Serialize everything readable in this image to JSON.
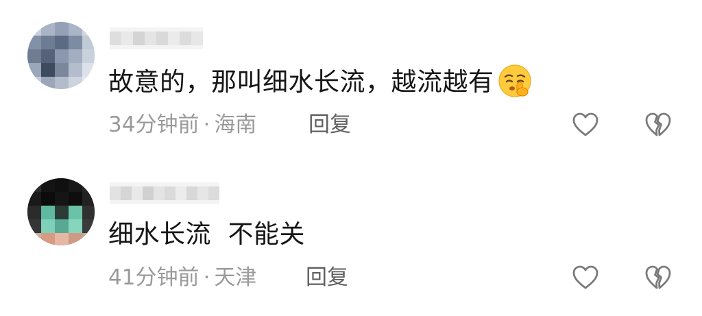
{
  "comments": [
    {
      "avatar_icon": "pixelated-avatar-icon",
      "username": "",
      "text": "故意的，那叫细水长流，越流越有",
      "emoji": "shushing-face-emoji",
      "time": "34分钟前",
      "separator": "·",
      "location": "海南",
      "reply_label": "回复",
      "like_icon": "heart-outline-icon",
      "dislike_icon": "broken-heart-icon"
    },
    {
      "avatar_icon": "pixelated-avatar-icon",
      "username": "",
      "text": "细水长流  不能关",
      "time": "41分钟前",
      "separator": "·",
      "location": "天津",
      "reply_label": "回复",
      "like_icon": "heart-outline-icon",
      "dislike_icon": "broken-heart-icon"
    }
  ],
  "colors": {
    "body_text": "#161616",
    "meta_text": "#9a9a9a",
    "reply_text": "#606060",
    "icon_stroke": "#7a7a7a"
  }
}
